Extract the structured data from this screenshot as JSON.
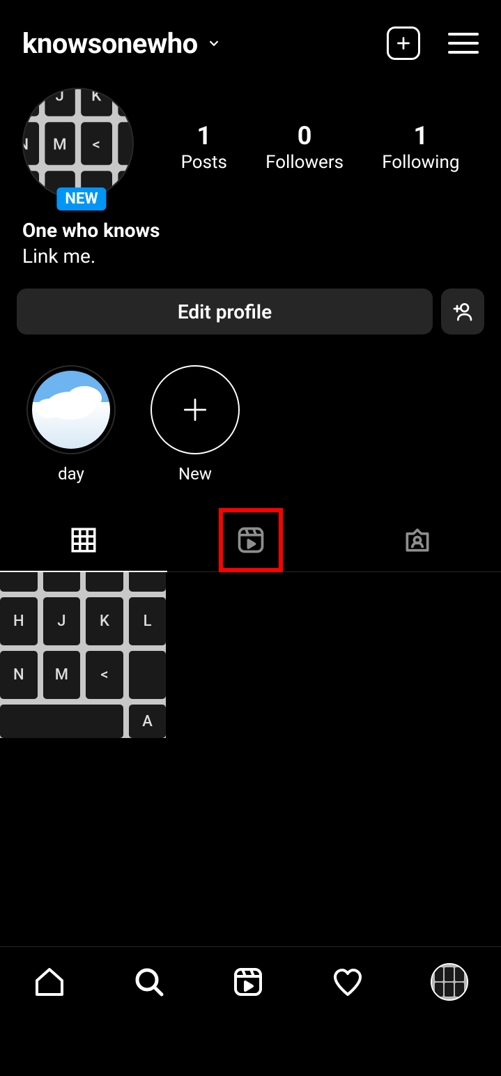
{
  "header": {
    "username": "knowsonewho"
  },
  "profile": {
    "avatar_badge": "NEW",
    "display_name": "One who knows",
    "bio": "Link me."
  },
  "stats": {
    "posts_count": "1",
    "posts_label": "Posts",
    "followers_count": "0",
    "followers_label": "Followers",
    "following_count": "1",
    "following_label": "Following"
  },
  "actions": {
    "edit_profile": "Edit profile"
  },
  "highlights": [
    {
      "label": "day"
    },
    {
      "label": "New"
    }
  ],
  "tabs": {
    "active": "grid",
    "highlighted": "reels"
  }
}
